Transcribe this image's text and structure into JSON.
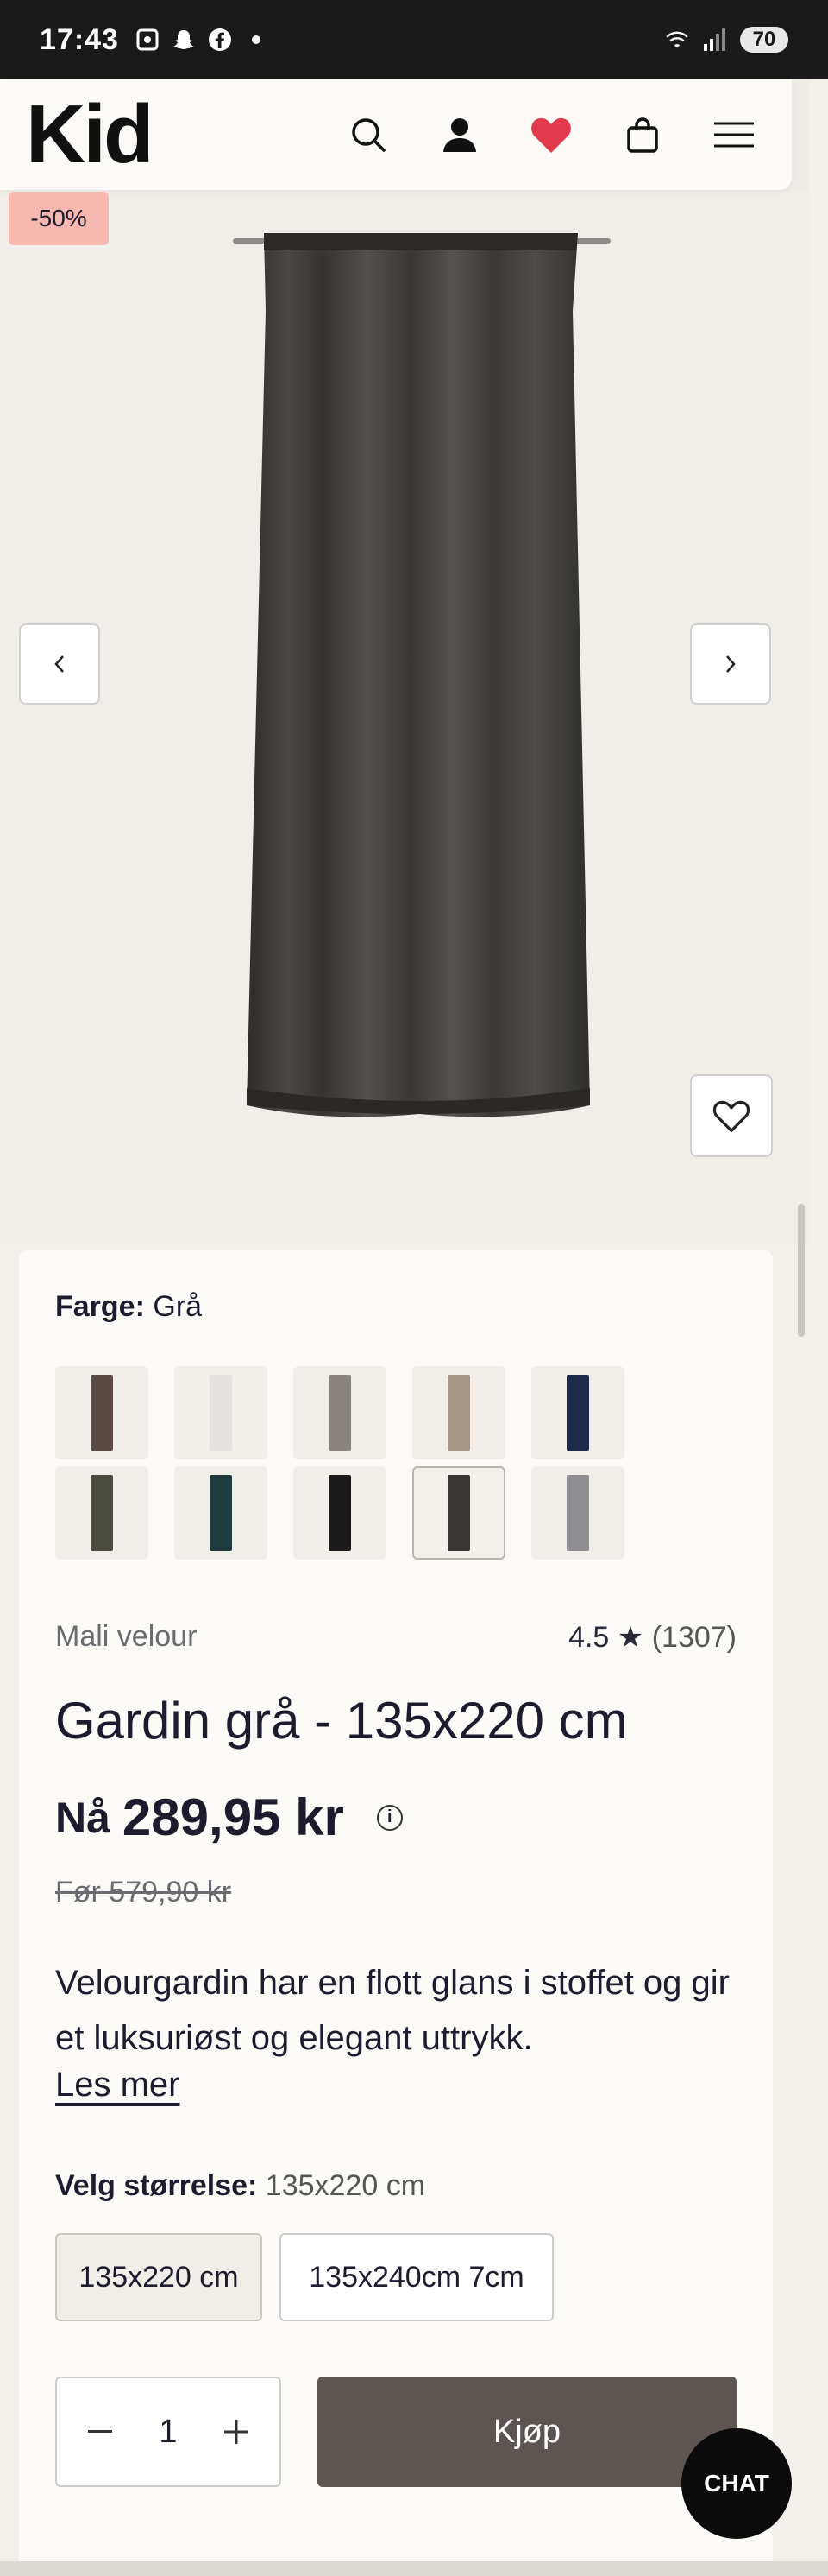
{
  "status_bar": {
    "time": "17:43",
    "battery": "70",
    "icons": [
      "screenshot-icon",
      "snapchat-icon",
      "facebook-icon",
      "dot-icon",
      "wifi-icon",
      "signal-icon",
      "battery-icon"
    ]
  },
  "header": {
    "logo": "Kid",
    "icons": [
      "search-icon",
      "account-icon",
      "wishlist-heart-icon",
      "bag-icon",
      "menu-icon"
    ],
    "heart_color": "#e03a4c"
  },
  "gallery": {
    "discount_badge": "-50%",
    "prev_icon": "chevron-left-icon",
    "next_icon": "chevron-right-icon",
    "favorite_icon": "heart-outline-icon"
  },
  "product": {
    "color_label": "Farge:",
    "color_value": "Grå",
    "swatches": [
      {
        "color": "#5a4a42",
        "selected": false
      },
      {
        "color": "#e4e2df",
        "selected": false
      },
      {
        "color": "#8a8480",
        "selected": false
      },
      {
        "color": "#a59584",
        "selected": false
      },
      {
        "color": "#1e2a4a",
        "selected": false
      },
      {
        "color": "#4a4d3c",
        "selected": false
      },
      {
        "color": "#1e3b3e",
        "selected": false
      },
      {
        "color": "#1b1b1b",
        "selected": false
      },
      {
        "color": "#3a3634",
        "selected": true
      },
      {
        "color": "#8e8d92",
        "selected": false
      }
    ],
    "brand": "Mali velour",
    "rating": "4.5",
    "rating_star": "★",
    "review_count": "(1307)",
    "title": "Gardin grå - 135x220 cm",
    "price_prefix": "Nå",
    "price": "289,95 kr",
    "before_price": "Før 579,90 kr",
    "description": "Velourgardin har en flott glans i stoffet og gir et luksuriøst og elegant uttrykk.",
    "read_more": "Les mer",
    "size_label": "Velg størrelse:",
    "size_value": "135x220 cm",
    "sizes": [
      "135x220 cm",
      "135x240cm 7cm"
    ],
    "quantity": "1",
    "buy_label": "Kjøp"
  },
  "chat": {
    "label": "CHAT"
  }
}
